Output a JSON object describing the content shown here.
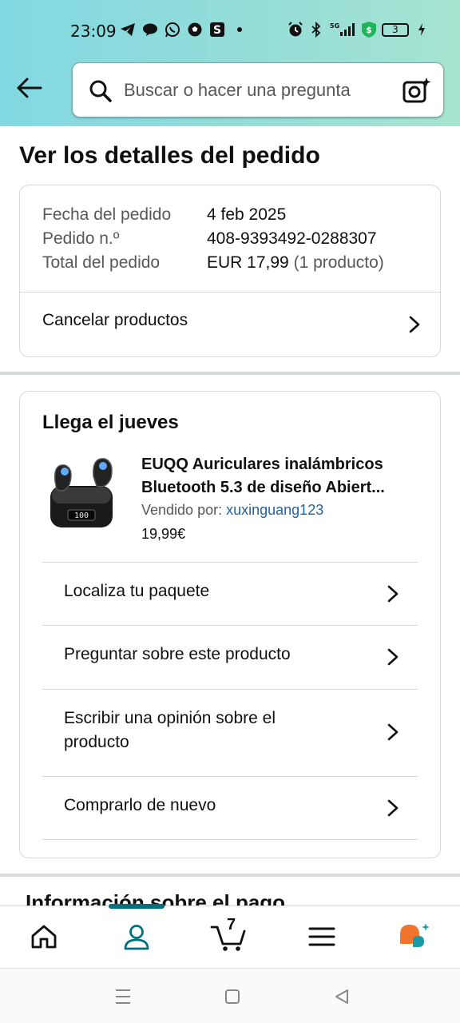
{
  "status_bar": {
    "time": "23:09",
    "left_icons": [
      "telegram-icon",
      "chat-bubble-icon",
      "whatsapp-icon",
      "soccer-ball-icon",
      "s-app-icon",
      "dot-icon"
    ],
    "right_icons": [
      "alarm-icon",
      "bluetooth-icon",
      "5g-signal-icon",
      "shield-dollar-icon"
    ],
    "battery": "3"
  },
  "header": {
    "search_placeholder": "Buscar o hacer una pregunta"
  },
  "page_title": "Ver los detalles del pedido",
  "order_summary": {
    "rows": [
      {
        "label": "Fecha del pedido",
        "value": "4 feb 2025",
        "extra": ""
      },
      {
        "label": "Pedido n.º",
        "value": "408-9393492-0288307",
        "extra": ""
      },
      {
        "label": "Total del pedido",
        "value": "EUR 17,99",
        "extra": "(1 producto)"
      }
    ],
    "cancel_label": "Cancelar productos"
  },
  "shipment": {
    "heading": "Llega el jueves",
    "product": {
      "title_line1": "EUQQ Auriculares inalámbricos",
      "title_line2": "Bluetooth 5.3 de diseño Abiert...",
      "seller_prefix": "Vendido por:",
      "seller_name": "xuxinguang123",
      "price": "19,99€",
      "image_display_text": "100"
    },
    "actions": [
      {
        "label": "Localiza tu paquete"
      },
      {
        "label": "Preguntar sobre este producto"
      },
      {
        "label_line1": "Escribir una opinión sobre el",
        "label_line2": "producto"
      },
      {
        "label": "Comprarlo de nuevo"
      }
    ]
  },
  "next_section_peek": "Información sobre el pago",
  "bottom_nav": {
    "items": [
      "home-icon",
      "account-icon",
      "cart-icon",
      "menu-icon",
      "rufus-icon"
    ],
    "cart_count": "7",
    "active": "account-icon",
    "accent_color": "#00707e"
  },
  "colors": {
    "header_gradient_start": "#82d8e3",
    "header_gradient_end": "#a6e4d0",
    "link": "#2162a1",
    "rufus_orange": "#f3742b",
    "rufus_teal": "#1a9aa7"
  }
}
